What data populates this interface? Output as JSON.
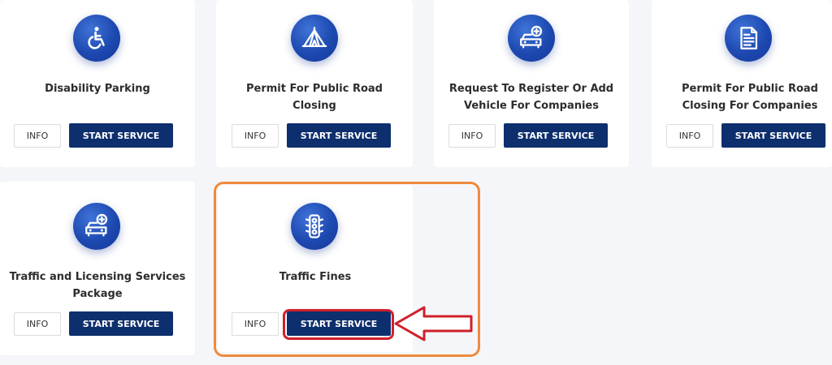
{
  "cards": [
    {
      "title": "Disability Parking",
      "icon": "wheelchair-icon",
      "info_label": "INFO",
      "start_label": "START SERVICE"
    },
    {
      "title": "Permit For Public Road Closing",
      "icon": "tent-icon",
      "info_label": "INFO",
      "start_label": "START SERVICE"
    },
    {
      "title": "Request To Register Or Add Vehicle For Companies",
      "icon": "car-add-icon",
      "info_label": "INFO",
      "start_label": "START SERVICE"
    },
    {
      "title": "Permit For Public Road Closing For Companies",
      "icon": "document-icon",
      "info_label": "INFO",
      "start_label": "START SERVICE"
    },
    {
      "title": "Traffic and Licensing Services Package",
      "icon": "car-add-icon",
      "info_label": "INFO",
      "start_label": "START SERVICE"
    },
    {
      "title": "Traffic Fines",
      "icon": "traffic-light-icon",
      "info_label": "INFO",
      "start_label": "START SERVICE"
    }
  ],
  "colors": {
    "page_background": "#f5f6fa",
    "card_background": "#ffffff",
    "icon_blue": "#1d49b0",
    "button_navy": "#0e2f6e",
    "highlight_orange": "#ef8a3b",
    "annotation_red": "#d0202a"
  }
}
